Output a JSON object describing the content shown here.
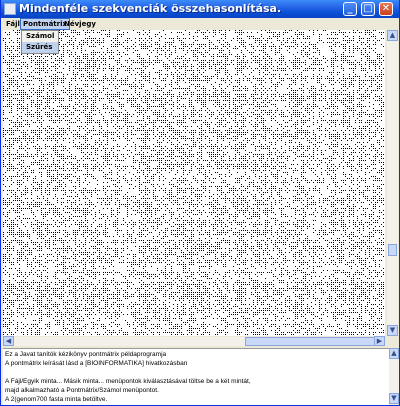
{
  "window": {
    "title": "Mindenféle szekvenciák összehasonlítása."
  },
  "menu": {
    "file": "Fájl",
    "dotmatrix": "Pontmátrix",
    "about": "Névjegy"
  },
  "dropdown": {
    "compute": "Számol",
    "filter": "Szűrés"
  },
  "text": [
    "Ez a Javat tanítók kézikönyv pontmátrix példaprogramja",
    "A pontmátrix leírását lásd a [BIOINFORMATIKA] hivatkozásban",
    "",
    "A Fájl/Egyik minta... Másik minta... menüpontok kiválasztásával töltse be a két mintát,",
    "majd alkalmazható a Pontmátrix/Számol menüpontot.",
    "A 2(genom700 fasta minta betöltve."
  ],
  "colors": {
    "titlebar": "#0b4fd6",
    "menu_highlight": "#c1d2ee",
    "plot_bg": "#ffffff"
  }
}
